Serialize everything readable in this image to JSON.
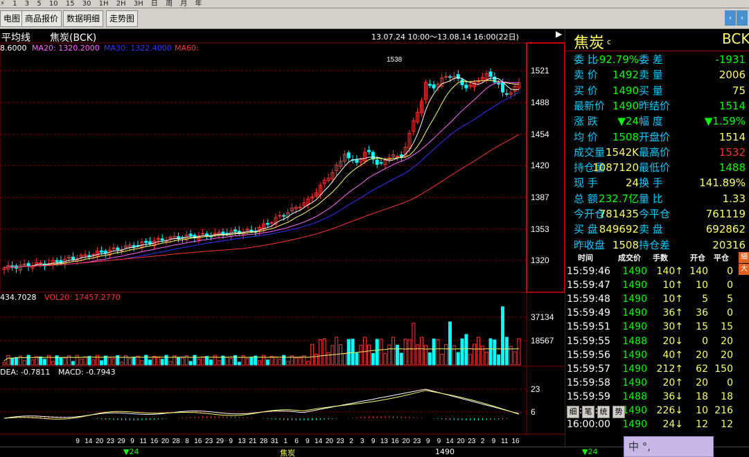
{
  "toolbar": {
    "items": [
      "⚡",
      "1",
      "3",
      "5",
      "10",
      "15",
      "30",
      "1H",
      "2H",
      "3H",
      "日",
      "周",
      "月",
      "年"
    ]
  },
  "tabs": [
    "电图",
    "商品报价",
    "数据明细",
    "走势图"
  ],
  "chart": {
    "title": "平均线",
    "symbol": "焦炭(BCK)",
    "range": "13.07.24 10:00～13.08.14 16:00(22日)",
    "ma_labels": [
      "8.6000",
      "MA20: 1320.2000",
      "MA30: 1322.4000",
      "MA60:"
    ],
    "ma_colors": [
      "#ffffff",
      "#ff66ff",
      "#3333ff",
      "#ff3333"
    ],
    "price_ticks": [
      "1521",
      "1488",
      "1454",
      "1420",
      "1387",
      "1353",
      "1320"
    ],
    "peak_label": "1538",
    "vol_labels": [
      "434.7028",
      "VOL20: 17457.2770"
    ],
    "vol_ticks": [
      "37134",
      "18567"
    ],
    "macd_labels": [
      "DEA: -0.7811",
      "MACD: -0.7943"
    ],
    "macd_ticks": [
      "23",
      "6"
    ],
    "x_ticks": [
      "9",
      "14",
      "20",
      "23",
      "29",
      "9",
      "11",
      "16",
      "20",
      "28",
      "8",
      "16",
      "23",
      "29",
      "9",
      "13",
      "21",
      "28",
      "31",
      "1",
      "6",
      "9",
      "14",
      "20",
      "23",
      "2",
      "3",
      "9",
      "13",
      "16",
      "20",
      "23",
      "9",
      "9",
      "14",
      "20",
      "23",
      "2",
      "9",
      "11",
      "16"
    ]
  },
  "quote": {
    "name": "焦炭",
    "sub": "c",
    "code": "BCK",
    "rows": [
      {
        "l1": "委  比",
        "v1": "-92.79%",
        "l2": "委  差",
        "v2": "-1931"
      },
      {
        "l1": "卖  价",
        "v1": "1492",
        "l2": "卖  量",
        "v2": "2006"
      },
      {
        "l1": "买  价",
        "v1": "1490",
        "l2": "买  量",
        "v2": "75"
      },
      {
        "l1": "最新价",
        "v1": "1490",
        "l2": "昨结价",
        "v2": "1514"
      },
      {
        "l1": "涨  跌",
        "v1": "▼24",
        "l2": "幅  度",
        "v2": "▼1.59%"
      },
      {
        "l1": "均  价",
        "v1": "1508",
        "l2": "开盘价",
        "v2": "1514"
      },
      {
        "l1": "成交量",
        "v1": "1542K",
        "l2": "最高价",
        "v2": "1532"
      },
      {
        "l1": "持仓量",
        "v1": "1087120",
        "l2": "最低价",
        "v2": "1488"
      },
      {
        "l1": "现  手",
        "v1": "24",
        "l2": "换  手",
        "v2": "141.89%"
      },
      {
        "l1": "总  额",
        "v1": "232.7亿",
        "l2": "量  比",
        "v2": "1.33"
      },
      {
        "l1": "今开仓",
        "v1": "781435",
        "l2": "今平仓",
        "v2": "761119"
      },
      {
        "l1": "买  盘",
        "v1": "849692",
        "l2": "卖  盘",
        "v2": "692862"
      },
      {
        "l1": "昨收盘",
        "v1": "1508",
        "l2": "持仓差",
        "v2": "20316"
      }
    ]
  },
  "ticks": {
    "headers": [
      "时间",
      "成交价",
      "手数",
      "开仓",
      "平仓"
    ],
    "rows": [
      [
        "15:59:46",
        "1490",
        "140↑",
        "140",
        "0"
      ],
      [
        "15:59:47",
        "1490",
        "10↑",
        "10",
        "0"
      ],
      [
        "15:59:48",
        "1490",
        "10↑",
        "5",
        "5"
      ],
      [
        "15:59:49",
        "1490",
        "36↑",
        "36",
        "0"
      ],
      [
        "15:59:51",
        "1490",
        "30↑",
        "15",
        "15"
      ],
      [
        "15:59:55",
        "1488",
        "20↓",
        "0",
        "20"
      ],
      [
        "15:59:56",
        "1490",
        "40↑",
        "20",
        "20"
      ],
      [
        "15:59:57",
        "1490",
        "212↑",
        "62",
        "150"
      ],
      [
        "15:59:58",
        "1490",
        "20↑",
        "20",
        "0"
      ],
      [
        "15:59:59",
        "1488",
        "36↓",
        "18",
        "18"
      ],
      [
        "15:59:59",
        "1490",
        "226↓",
        "10",
        "216"
      ],
      [
        "16:00:00",
        "1490",
        "24↓",
        "12",
        "12"
      ]
    ]
  },
  "sidebtns": [
    "细",
    "笔",
    "统",
    "势"
  ],
  "rightbtns": [
    "細",
    "大"
  ],
  "bottom": {
    "left": "▼24",
    "mid": "焦炭",
    "right": "1490",
    "r2": "▼24",
    "ime": "中 °,"
  }
}
